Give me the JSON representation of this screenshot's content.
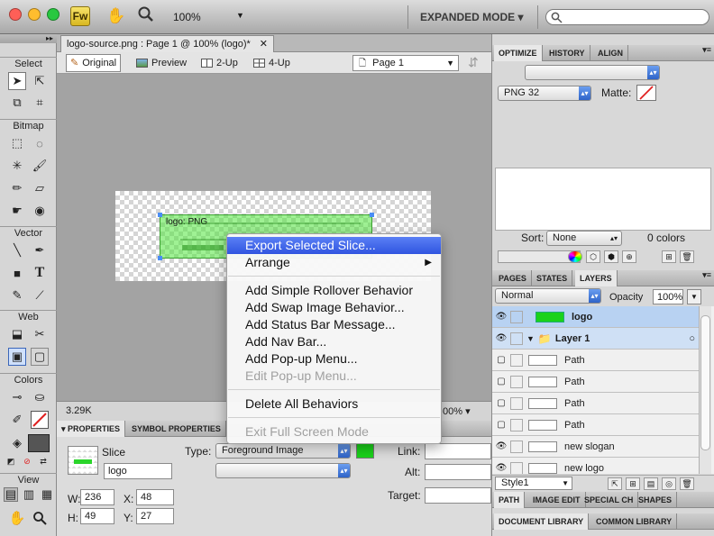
{
  "toolbar": {
    "zoom": "100%",
    "mode": "EXPANDED MODE",
    "search_placeholder": ""
  },
  "tools": {
    "section_select": "Select",
    "section_bitmap": "Bitmap",
    "section_vector": "Vector",
    "section_web": "Web",
    "section_colors": "Colors",
    "section_view": "View"
  },
  "document": {
    "tab_title": "logo-source.png : Page 1 @ 100% (logo)*",
    "views": [
      "Original",
      "Preview",
      "2-Up",
      "4-Up"
    ],
    "page": "Page 1",
    "slice_label": "logo: PNG",
    "size": "3.29K",
    "zoom_status": "00%"
  },
  "properties": {
    "tab_properties": "PROPERTIES",
    "tab_symbol": "SYMBOL PROPERTIES",
    "object_type": "Slice",
    "name": "logo",
    "type_label": "Type:",
    "type_value": "Foreground Image",
    "link_label": "Link:",
    "alt_label": "Alt:",
    "target_label": "Target:",
    "w_label": "W:",
    "w": "236",
    "h_label": "H:",
    "h": "49",
    "x_label": "X:",
    "x": "48",
    "y_label": "Y:",
    "y": "27"
  },
  "context_menu": {
    "items": [
      {
        "label": "Export Selected Slice...",
        "state": "highlighted"
      },
      {
        "label": "Arrange",
        "state": "submenu"
      },
      {
        "label": "Add Simple Rollover Behavior",
        "state": "normal"
      },
      {
        "label": "Add Swap Image Behavior...",
        "state": "normal"
      },
      {
        "label": "Add Status Bar Message...",
        "state": "normal"
      },
      {
        "label": "Add Nav Bar...",
        "state": "normal"
      },
      {
        "label": "Add Pop-up Menu...",
        "state": "normal"
      },
      {
        "label": "Edit Pop-up Menu...",
        "state": "disabled"
      },
      {
        "label": "Delete All Behaviors",
        "state": "normal"
      },
      {
        "label": "Exit Full Screen Mode",
        "state": "disabled"
      }
    ]
  },
  "optimize": {
    "tabs": [
      "OPTIMIZE",
      "HISTORY",
      "ALIGN"
    ],
    "format": "PNG 32",
    "matte_label": "Matte:",
    "sort_label": "Sort:",
    "sort_value": "None",
    "colors_count": "0 colors"
  },
  "layers": {
    "tabs": [
      "PAGES",
      "STATES",
      "LAYERS"
    ],
    "blend": "Normal",
    "opacity_label": "Opacity",
    "opacity": "100%",
    "rows": [
      {
        "name": "logo",
        "kind": "web"
      },
      {
        "name": "Layer 1",
        "kind": "folder"
      },
      {
        "name": "Path",
        "kind": "object"
      },
      {
        "name": "Path",
        "kind": "object"
      },
      {
        "name": "Path",
        "kind": "object"
      },
      {
        "name": "Path",
        "kind": "object"
      },
      {
        "name": "new slogan",
        "kind": "object"
      },
      {
        "name": "new logo",
        "kind": "object"
      }
    ],
    "style": "Style1"
  },
  "bottom_panels": {
    "row1": [
      "PATH",
      "IMAGE EDIT",
      "SPECIAL CH",
      "SHAPES"
    ],
    "row2": [
      "DOCUMENT LIBRARY",
      "COMMON LIBRARY"
    ]
  },
  "colors": {
    "accent": "#3055e0",
    "slice_green": "#50e63c",
    "menu_highlight": "#4a6cf0"
  }
}
